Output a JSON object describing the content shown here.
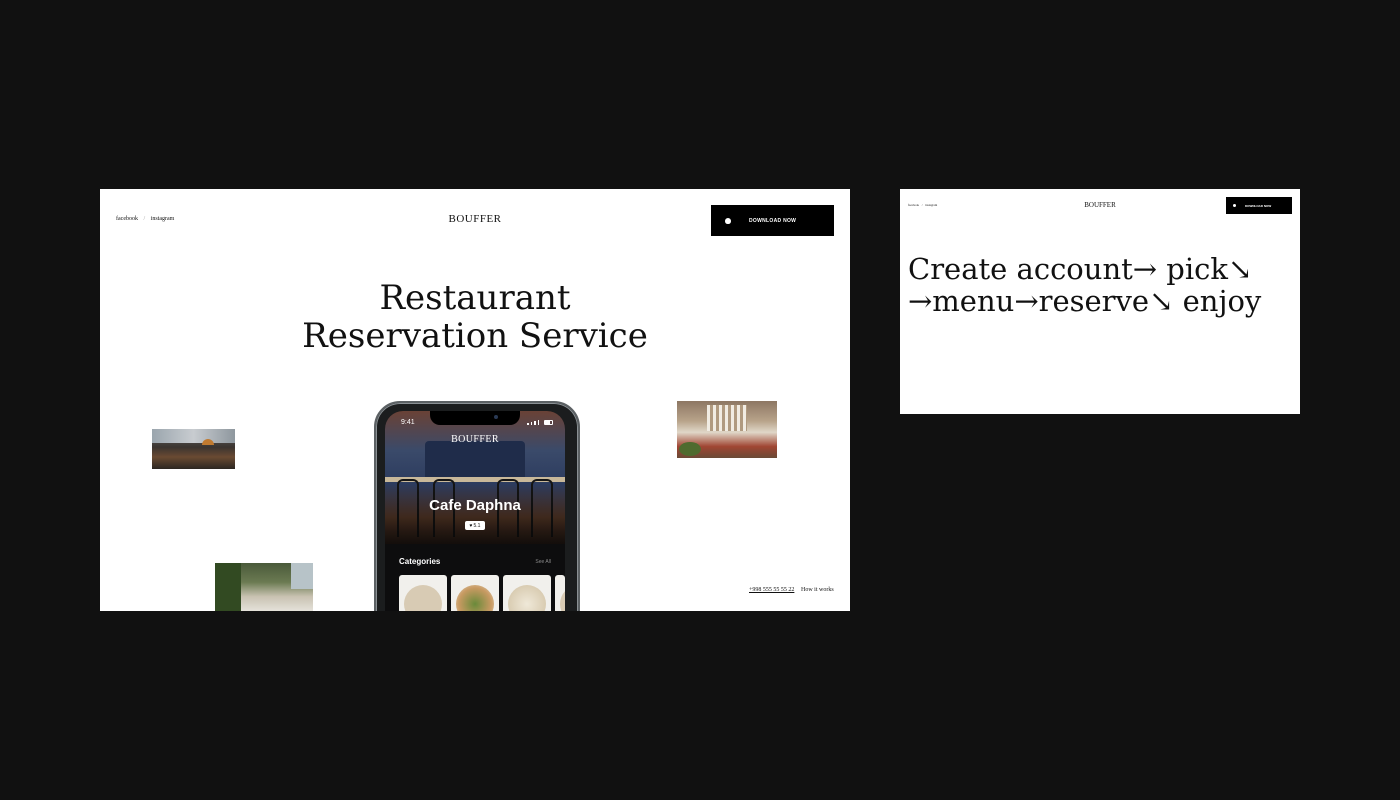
{
  "main": {
    "social": {
      "facebook": "facebook",
      "separator": "/",
      "instagram": "instagram"
    },
    "brand": "BOUFFER",
    "download_button": "DOWNLOAD NOW",
    "hero_line1": "Restaurant",
    "hero_line2": "Reservation Service",
    "phone_link": "+998 555 55 55 22",
    "how_link": "How it works"
  },
  "phone_app": {
    "time": "9:41",
    "brand": "BOUFFER",
    "cafe_name": "Cafe Daphna",
    "rating": "5.1",
    "categories_title": "Categories",
    "see_all": "See All"
  },
  "second": {
    "social": {
      "facebook": "facebook",
      "separator": "/",
      "instagram": "instagram"
    },
    "brand": "BOUFFER",
    "download_button": "DOWNLOAD NOW",
    "flow_text": "Create account→ pick↘ →menu→reserve↘ enjoy"
  },
  "colors": {
    "background": "#111111",
    "artboard": "#ffffff",
    "button": "#000000"
  }
}
